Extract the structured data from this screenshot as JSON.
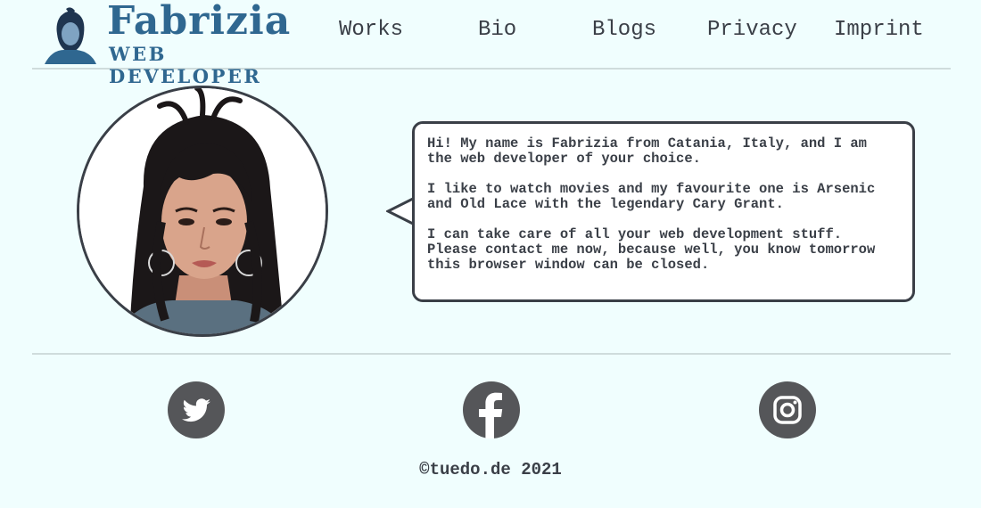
{
  "header": {
    "logo": {
      "title": "Fabrizia",
      "subtitle": "WEB DEVELOPER"
    },
    "nav": [
      {
        "label": "Works"
      },
      {
        "label": "Bio"
      },
      {
        "label": "Blogs"
      },
      {
        "label": "Privacy"
      },
      {
        "label": "Imprint"
      }
    ]
  },
  "main": {
    "bubble": {
      "paragraphs": [
        "Hi! My name is Fabrizia from Catania, Italy, and I am the web developer of your choice.",
        "I like to watch movies and my favourite one is Arsenic and Old Lace with the legendary Cary Grant.",
        "I can take care of all your web development stuff. Please contact me now, because well, you know tomorrow this browser window can be closed."
      ]
    }
  },
  "social": [
    {
      "icon": "twitter-icon"
    },
    {
      "icon": "facebook-icon"
    },
    {
      "icon": "instagram-icon"
    }
  ],
  "footer": {
    "copyright": "©tuedo.de 2021"
  },
  "colors": {
    "background": "#f0fefe",
    "text": "#3a3f47",
    "brand": "#2f6790",
    "icon_bg": "#555659",
    "divider": "#cfdcdc"
  }
}
